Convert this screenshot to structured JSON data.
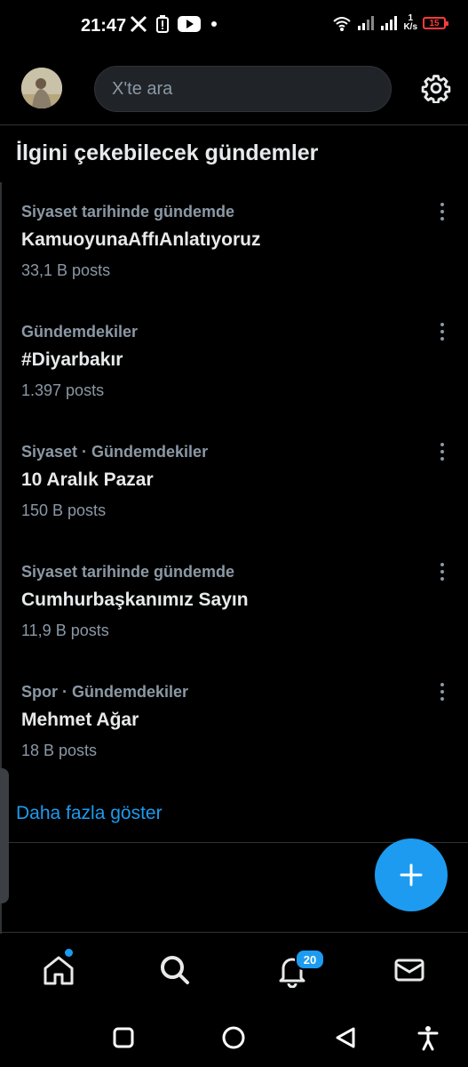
{
  "status_bar": {
    "time": "21:47",
    "net_speed_value": "1",
    "net_speed_unit": "K/s",
    "battery": "15",
    "battery_color": "#ff3b3b"
  },
  "search": {
    "placeholder": "X'te ara"
  },
  "section_title": "İlgini çekebilecek gündemler",
  "trends": [
    {
      "meta": "Siyaset tarihinde gündemde",
      "name": "KamuoyunaAffıAnlatıyoruz",
      "count": "33,1 B posts"
    },
    {
      "meta": "Gündemdekiler",
      "name": "#Diyarbakır",
      "count": "1.397 posts"
    },
    {
      "meta": "Siyaset · Gündemdekiler",
      "name": "10 Aralık Pazar",
      "count": "150 B posts"
    },
    {
      "meta": "Siyaset tarihinde gündemde",
      "name": "Cumhurbaşkanımız Sayın",
      "count": "11,9 B posts"
    },
    {
      "meta": "Spor · Gündemdekiler",
      "name": "Mehmet Ağar",
      "count": "18 B posts"
    }
  ],
  "show_more": "Daha fazla göster",
  "bottom_nav": {
    "notifications_badge": "20"
  },
  "icons": {
    "status": [
      "x-logo-icon",
      "battery-alert-icon",
      "youtube-icon",
      "dot-icon",
      "wifi-icon",
      "signal-icon",
      "signal-icon",
      "battery-icon"
    ],
    "top": [
      "avatar",
      "gear-icon"
    ],
    "nav": [
      "home-icon",
      "search-icon",
      "bell-icon",
      "mail-icon"
    ],
    "system": [
      "square-icon",
      "circle-icon",
      "back-icon",
      "accessibility-icon"
    ]
  },
  "colors": {
    "accent": "#1d9bf0",
    "background": "#000000",
    "secondary_text": "#8b98a5"
  }
}
